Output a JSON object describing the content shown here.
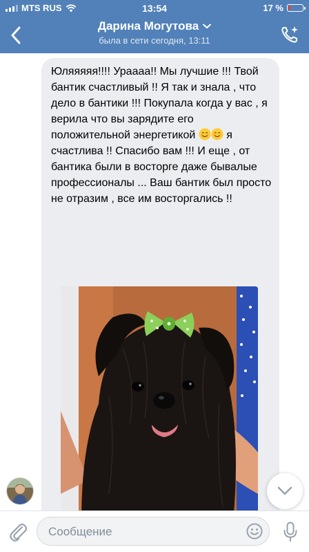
{
  "status_bar": {
    "carrier": "MTS RUS",
    "time": "13:54",
    "battery": "17 %",
    "battery_level": 0.17
  },
  "header": {
    "contact_name": "Дарина Могутова",
    "last_seen": "была в сети сегодня, 13:11"
  },
  "message": {
    "text_part1": "Юляяяяя!!!! Урaaaa!! Мы лучшие !!! Твой бантик счастливый !! Я так и знала , что дело в бантики !!! Покупала когда у вас , я верила что вы зарядите его положительной энергетикой ",
    "text_part2": "я счастлива !! Спасибо вам !!! И еще , от бантика были в восторге даже бывалые профессионалы ... Ваш бантик был просто не отразим , все им восторгались !!"
  },
  "composer": {
    "placeholder": "Сообщение"
  },
  "colors": {
    "header_bg": "#5181b8",
    "bubble_bg": "#ebedf0",
    "icon_blue": "#5181b8",
    "icon_gray": "#99a2ad"
  },
  "icons": [
    "back-icon",
    "chevron-down-icon",
    "video-call-icon",
    "smile-emoji-icon",
    "scroll-down-icon",
    "attach-icon",
    "emoji-icon",
    "microphone-icon",
    "wifi-icon"
  ]
}
